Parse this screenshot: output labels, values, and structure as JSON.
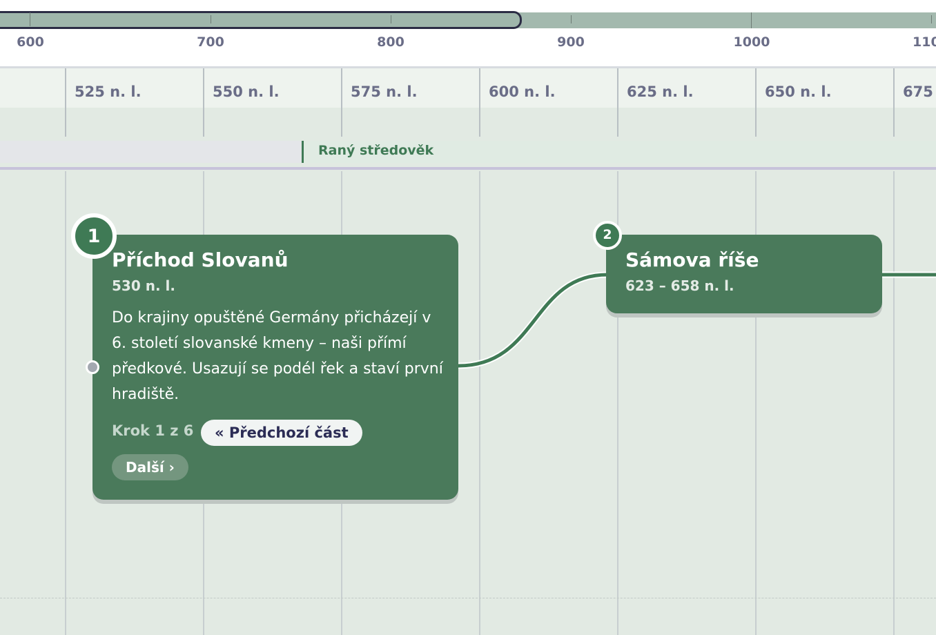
{
  "overview": {
    "labels": [
      "600",
      "700",
      "800",
      "900",
      "1000",
      "110"
    ],
    "colors": {
      "track": "#a3b9ae",
      "window_border": "#2b2c44"
    }
  },
  "scale": {
    "labels": [
      "525 n. l.",
      "550 n. l.",
      "575 n. l.",
      "600 n. l.",
      "625 n. l.",
      "650 n. l.",
      "675"
    ]
  },
  "era": {
    "label": "Raný středověk",
    "color": "#3f7a55"
  },
  "events": [
    {
      "number": "1",
      "title": "Příchod Slovanů",
      "date": "530 n. l.",
      "description": "Do krajiny opuštěné Germány přicházejí v 6. století slovanské kmeny – naši přímí předkové. Usazují se podél řek a staví první hradiště.",
      "step": "Krok 1 z 6",
      "prev_label": "« Předchozí část",
      "next_label": "Další ›"
    },
    {
      "number": "2",
      "title": "Sámova říše",
      "date": "623 – 658 n. l."
    }
  ],
  "colors": {
    "card": "#4a7a5b",
    "accent": "#3f7a55",
    "background": "#e2eae3",
    "scale_text": "#6a6d87"
  }
}
